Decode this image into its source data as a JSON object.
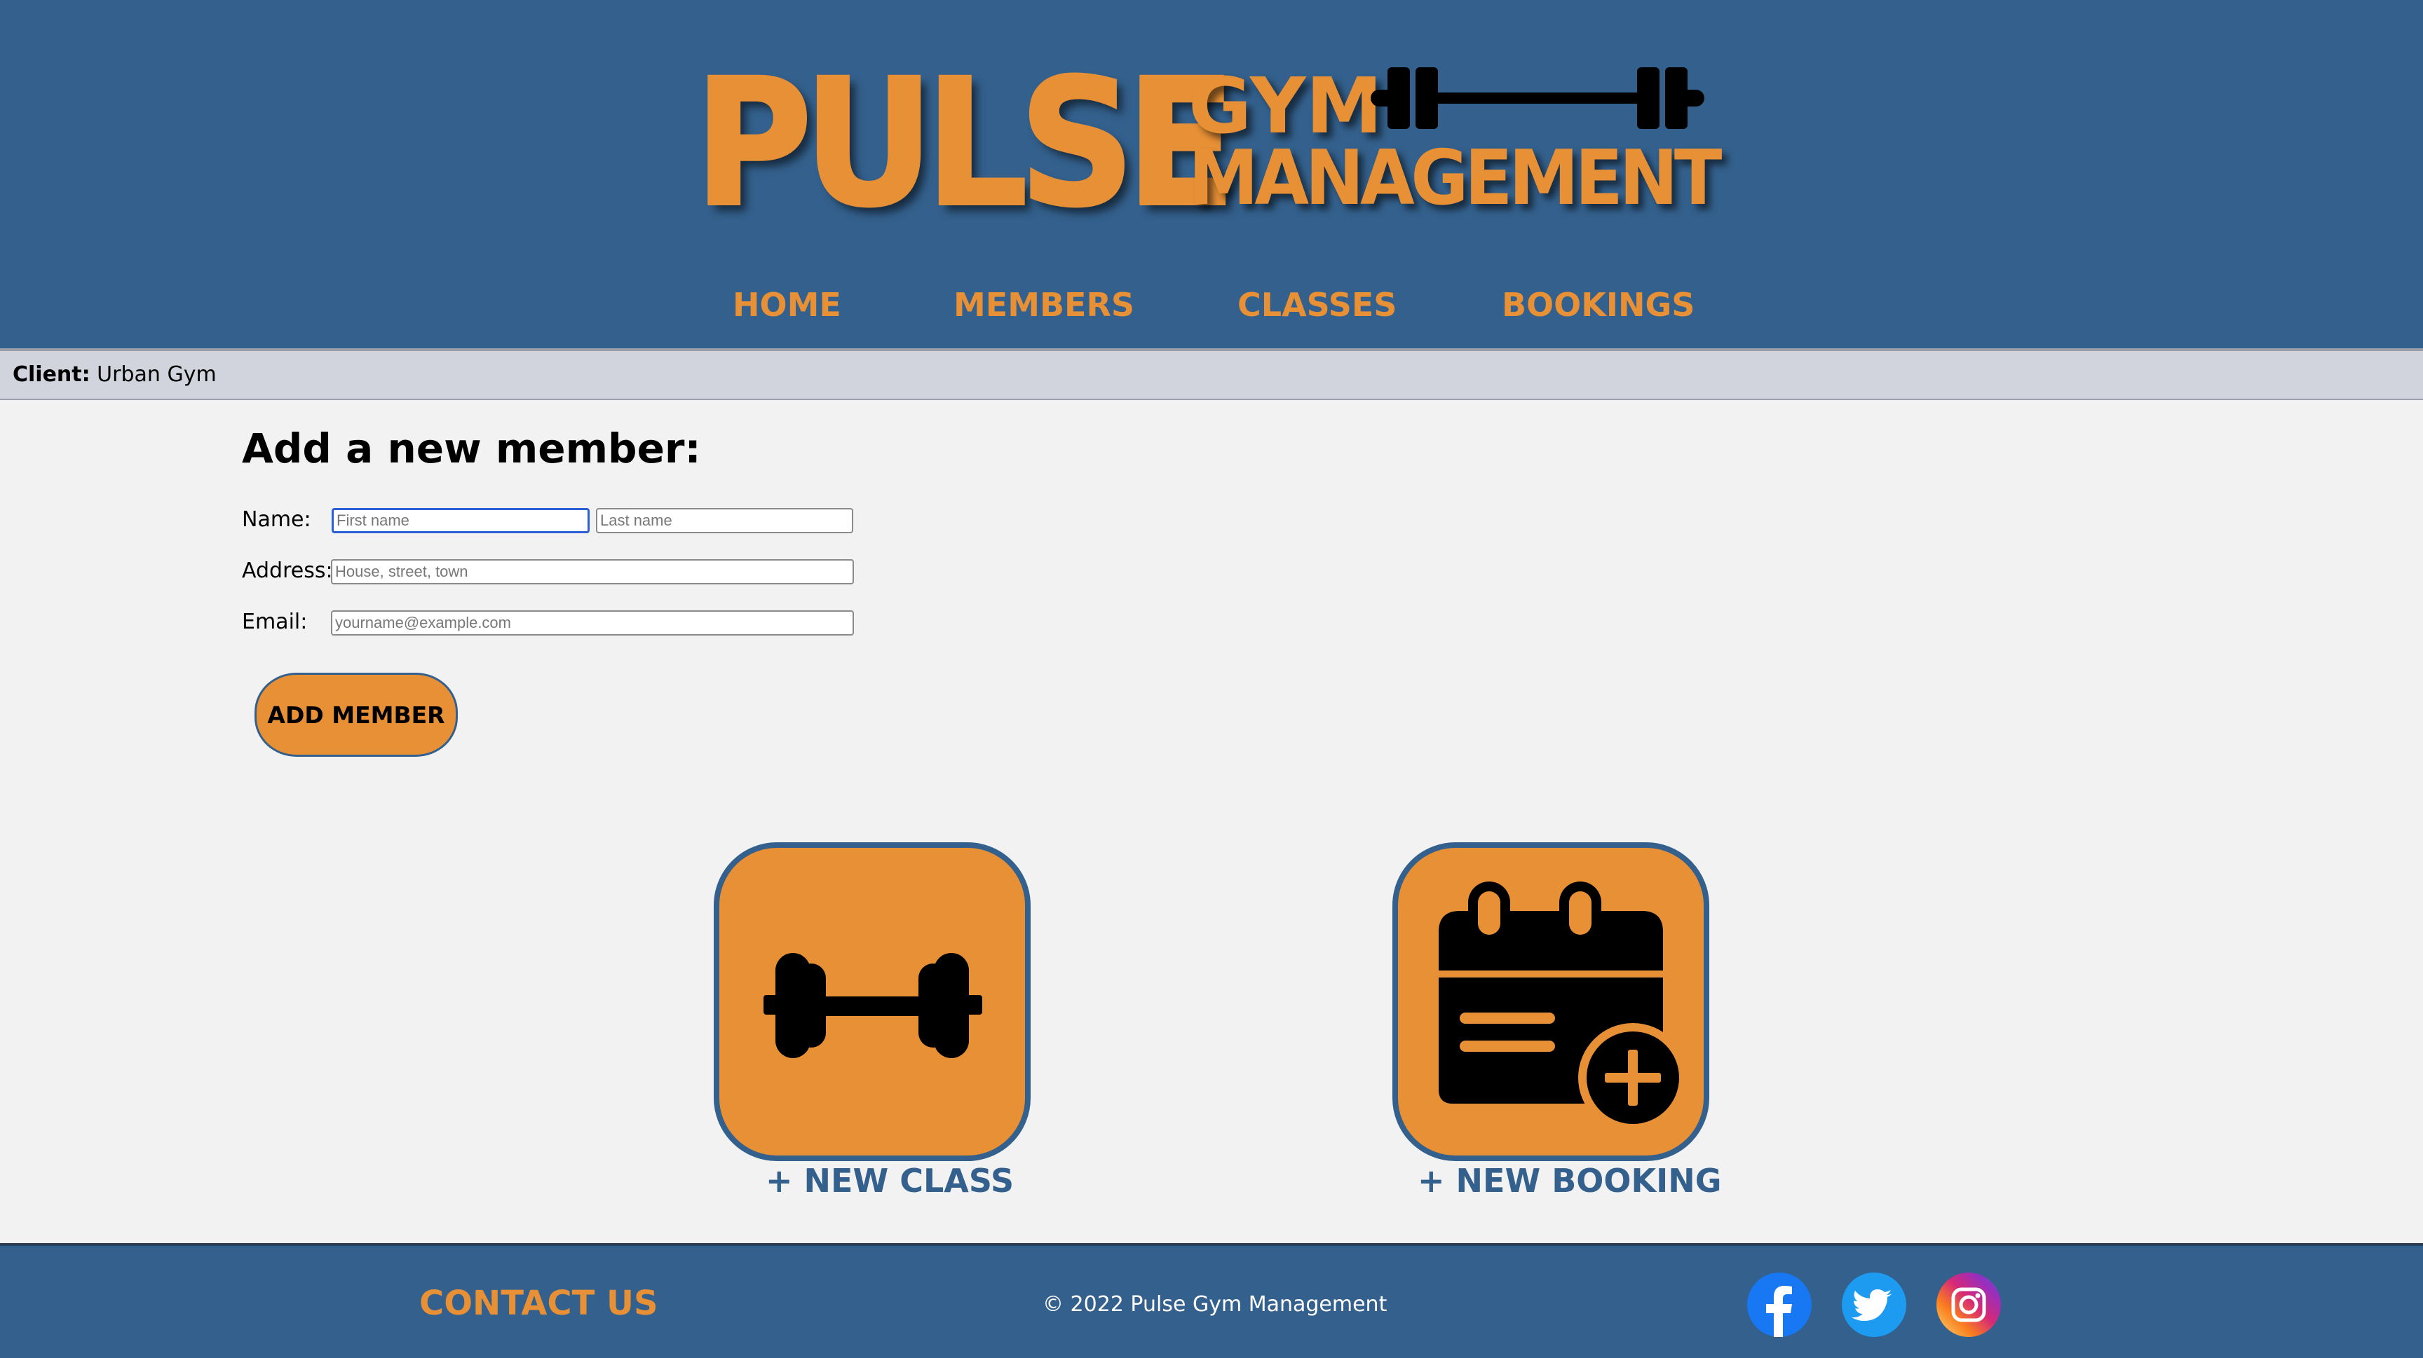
{
  "header": {
    "logo": {
      "word_main": "PULSE",
      "word_top": "GYM",
      "word_bottom": "MANAGEMENT"
    },
    "nav": [
      {
        "label": "HOME"
      },
      {
        "label": "MEMBERS"
      },
      {
        "label": "CLASSES"
      },
      {
        "label": "BOOKINGS"
      }
    ]
  },
  "client_bar": {
    "label": "Client:",
    "value": "Urban Gym"
  },
  "form": {
    "title": "Add a new member:",
    "name_label": "Name:",
    "first_name_placeholder": "First name",
    "last_name_placeholder": "Last name",
    "address_label": "Address:",
    "address_placeholder": "House, street, town",
    "email_label": "Email:",
    "email_placeholder": "yourname@example.com",
    "submit_label": "ADD MEMBER"
  },
  "tiles": {
    "new_class": {
      "label": "+ NEW CLASS",
      "icon": "dumbbell-icon"
    },
    "new_booking": {
      "label": "+ NEW BOOKING",
      "icon": "calendar-add-icon"
    }
  },
  "footer": {
    "contact_label": "CONTACT US",
    "copyright": "© 2022 Pulse Gym Management",
    "social": [
      {
        "icon": "facebook-icon"
      },
      {
        "icon": "twitter-icon"
      },
      {
        "icon": "instagram-icon"
      }
    ]
  },
  "colors": {
    "brand_blue": "#33608c",
    "brand_orange": "#e79035",
    "client_bar_bg": "#d1d4dc",
    "page_bg": "#f2f2f2"
  }
}
